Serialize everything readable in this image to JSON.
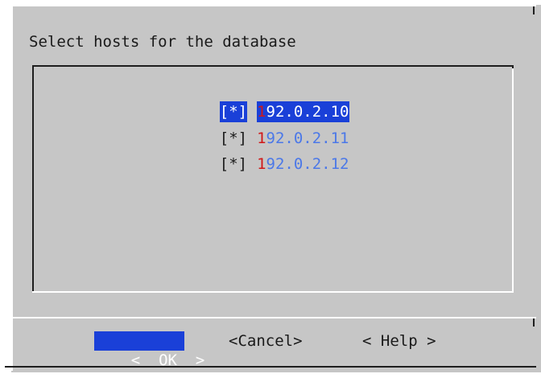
{
  "dialog": {
    "title": "Select hosts for the database"
  },
  "hosts": [
    {
      "mark": "[*]",
      "hotkey": "1",
      "rest": "92.0.2.10",
      "selected": true
    },
    {
      "mark": "[*]",
      "hotkey": "1",
      "rest": "92.0.2.11",
      "selected": false
    },
    {
      "mark": "[*]",
      "hotkey": "1",
      "rest": "92.0.2.12",
      "selected": false
    }
  ],
  "buttons": {
    "ok": {
      "left": "<",
      "label": "OK",
      "right": ">"
    },
    "cancel": "<Cancel>",
    "help": "< Help >"
  },
  "colors": {
    "background": "#c6c6c6",
    "selection": "#1a40d8",
    "hotkey": "#d01818",
    "item_text": "#4b78e8"
  }
}
